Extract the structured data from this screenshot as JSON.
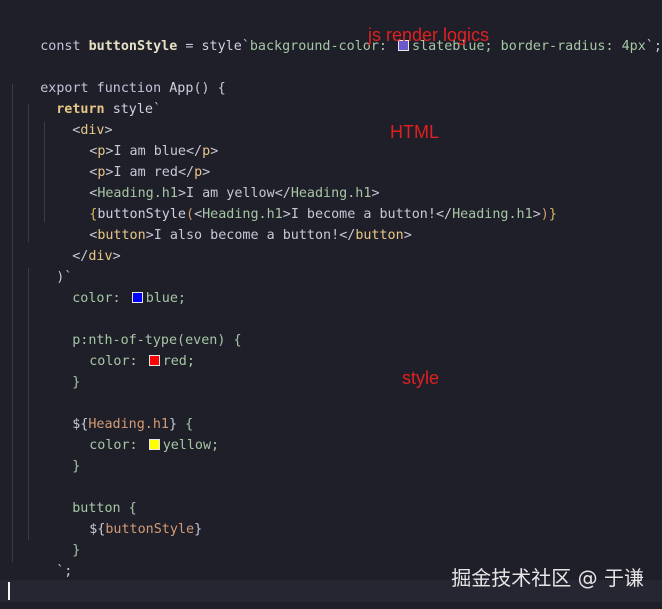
{
  "annotations": {
    "js_render": "js render logics",
    "html": "HTML",
    "style": "style"
  },
  "watermark": "掘金技术社区 @ 于谦",
  "swatches": {
    "slateblue": "#6a5acd",
    "blue": "#0000ff",
    "red": "#ff0000",
    "yellow": "#ffff00"
  },
  "code": {
    "l1": {
      "kw": "const ",
      "name": "buttonStyle",
      "eq": " = ",
      "fn": "style",
      "bt": "`",
      "str1": "background-color: ",
      "str2": "slateblue; border-radius: 4px",
      "end": "`;"
    },
    "l3": {
      "kw": "export function ",
      "fn": "App",
      "rest": "() {"
    },
    "l4": {
      "kw": "return ",
      "fn": "style",
      "rest": "`"
    },
    "l5": {
      "lt": "<",
      "tag": "div",
      "gt": ">"
    },
    "l6": {
      "o1": "<",
      "tag1": "p",
      "o2": ">",
      "text": "I am blue",
      "c1": "</",
      "tag2": "p",
      "c2": ">"
    },
    "l7": {
      "o1": "<",
      "tag1": "p",
      "o2": ">",
      "text": "I am red",
      "c1": "</",
      "tag2": "p",
      "c2": ">"
    },
    "l8": {
      "o1": "<",
      "tag1": "Heading.h1",
      "o2": ">",
      "text": "I am yellow",
      "c1": "</",
      "tag2": "Heading.h1",
      "c2": ">"
    },
    "l9": {
      "b1": "{",
      "fn": "buttonStyle",
      "p1": "(",
      "o1": "<",
      "tag1": "Heading.h1",
      "o2": ">",
      "text": "I become a button!",
      "c1": "</",
      "tag2": "Heading.h1",
      "c2": ">",
      "p2": ")",
      "b2": "}"
    },
    "l10": {
      "o1": "<",
      "tag1": "button",
      "o2": ">",
      "text": "I also become a button!",
      "c1": "</",
      "tag2": "button",
      "c2": ">"
    },
    "l11": {
      "c1": "</",
      "tag": "div",
      "c2": ">"
    },
    "l12": {
      "text": ")`"
    },
    "l13": {
      "prop": "color: ",
      "val": "blue;"
    },
    "l15": {
      "sel": "p:nth-of-type(even) {"
    },
    "l16": {
      "prop": "color: ",
      "val": "red;"
    },
    "l17": {
      "text": "}"
    },
    "l19": {
      "d": "${",
      "tag": "Heading.h1",
      "e": "}",
      "rest": " {"
    },
    "l20": {
      "prop": "color: ",
      "val": "yellow;"
    },
    "l21": {
      "text": "}"
    },
    "l23": {
      "sel": "button {"
    },
    "l24": {
      "d": "${",
      "name": "buttonStyle",
      "e": "}"
    },
    "l25": {
      "text": "}"
    },
    "l26": {
      "text": "`;"
    },
    "l27": {
      "text": "}"
    }
  }
}
